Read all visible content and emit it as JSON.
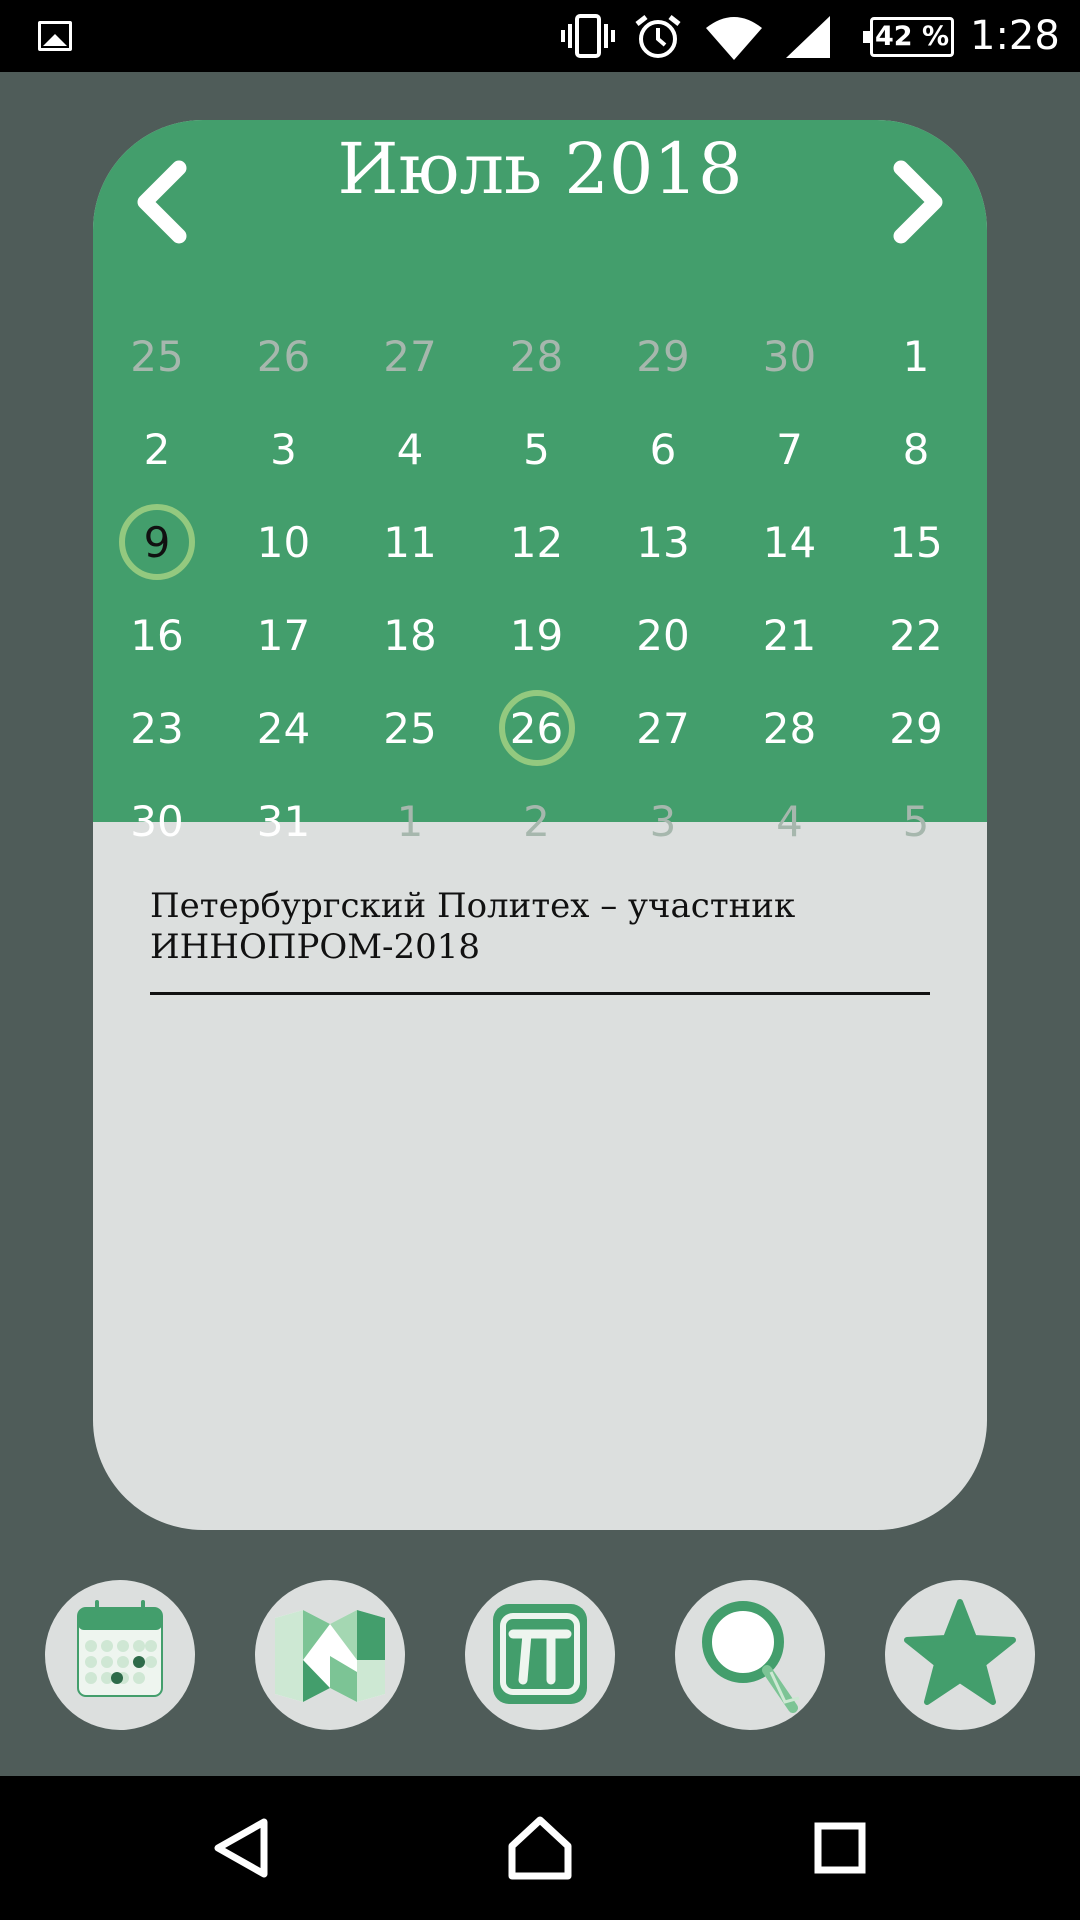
{
  "status_bar": {
    "battery": "42 %",
    "time": "1:28",
    "icons": [
      "gallery-icon",
      "vibrate-icon",
      "alarm-icon",
      "wifi-icon",
      "signal-icon",
      "battery-icon"
    ]
  },
  "calendar": {
    "title": "Июль 2018",
    "weeks": [
      [
        "25",
        "26",
        "27",
        "28",
        "29",
        "30",
        "1"
      ],
      [
        "2",
        "3",
        "4",
        "5",
        "6",
        "7",
        "8"
      ],
      [
        "9",
        "10",
        "11",
        "12",
        "13",
        "14",
        "15"
      ],
      [
        "16",
        "17",
        "18",
        "19",
        "20",
        "21",
        "22"
      ],
      [
        "23",
        "24",
        "25",
        "26",
        "27",
        "28",
        "29"
      ],
      [
        "30",
        "31",
        "1",
        "2",
        "3",
        "4",
        "5"
      ]
    ],
    "colors": {
      "header": "#439e6c",
      "ring": "#93c97f",
      "muted_day": "#a6b7ad"
    }
  },
  "events": [
    {
      "title": "Петербургский Политех – участник",
      "title2": "ИННОПРОМ-2018"
    }
  ],
  "tabs": [
    {
      "icon": "calendar-icon"
    },
    {
      "icon": "map-icon"
    },
    {
      "icon": "polytech-logo-icon"
    },
    {
      "icon": "search-icon"
    },
    {
      "icon": "star-icon"
    }
  ],
  "navbar": {
    "icons": [
      "back-icon",
      "home-icon",
      "recents-icon"
    ]
  }
}
